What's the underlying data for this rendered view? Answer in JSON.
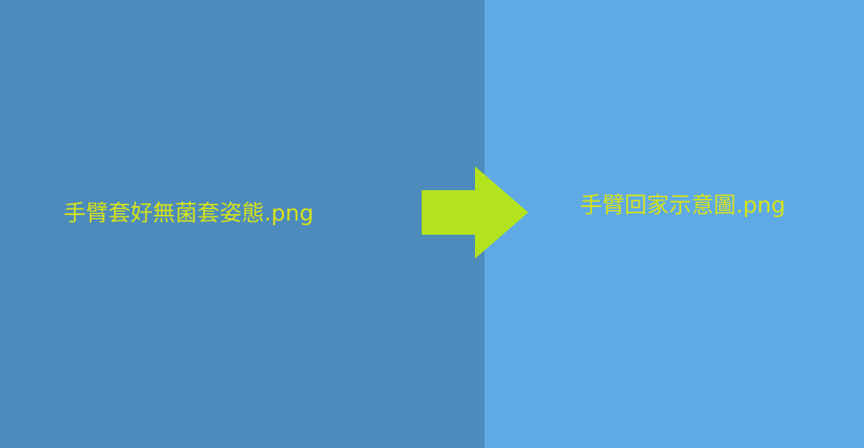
{
  "colors": {
    "left_panel": "#4c8bbb",
    "right_panel": "#5faae5",
    "text": "#d6e21a",
    "arrow": "#b3e31c"
  },
  "left": {
    "label": "手臂套好無菌套姿態.png"
  },
  "right": {
    "label": "手臂回家示意圖.png"
  },
  "arrow": {
    "icon": "right-arrow-icon"
  }
}
